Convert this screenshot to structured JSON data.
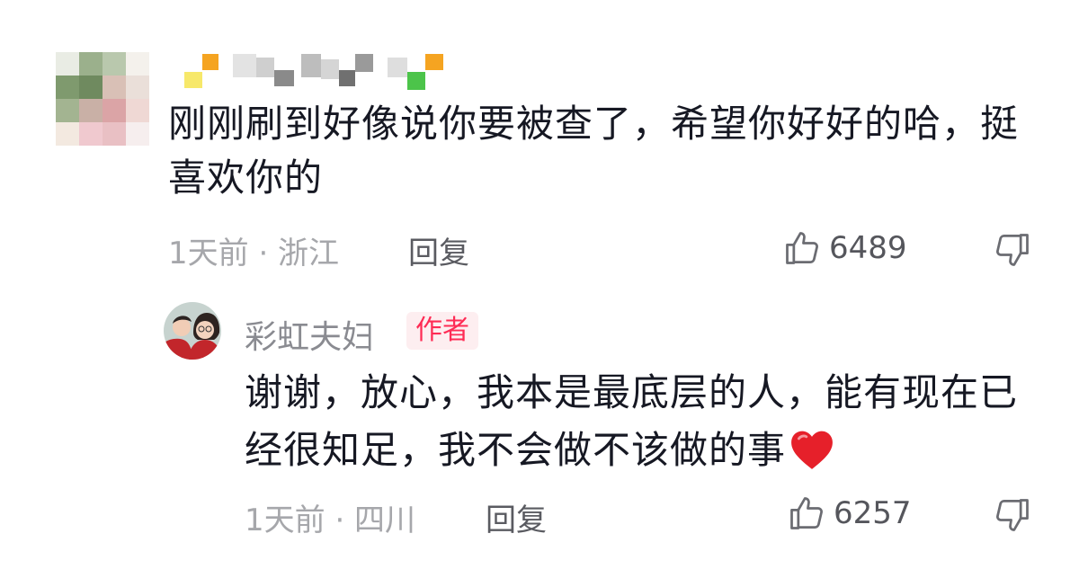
{
  "comment": {
    "text": "刚刚刷到好像说你要被查了，希望你好好的哈，挺喜欢你的",
    "time_location": "1天前 · 浙江",
    "reply_label": "回复",
    "like_count": "6489"
  },
  "reply": {
    "author_name": "彩虹夫妇",
    "author_badge": "作者",
    "text": "谢谢，放心，我本是最底层的人，能有现在已经很知足，我不会做不该做的事",
    "emoji": "❤️",
    "time_location": "1天前 · 四川",
    "reply_label": "回复",
    "like_count": "6257"
  },
  "icons": {
    "like": "thumbs-up-outline-icon",
    "dislike": "thumbs-down-outline-icon",
    "emoji": "red-heart-emoji"
  },
  "colors": {
    "badge_text": "#fe2c55",
    "badge_bg": "#fdeef0",
    "meta_text": "#a6a7ab"
  }
}
